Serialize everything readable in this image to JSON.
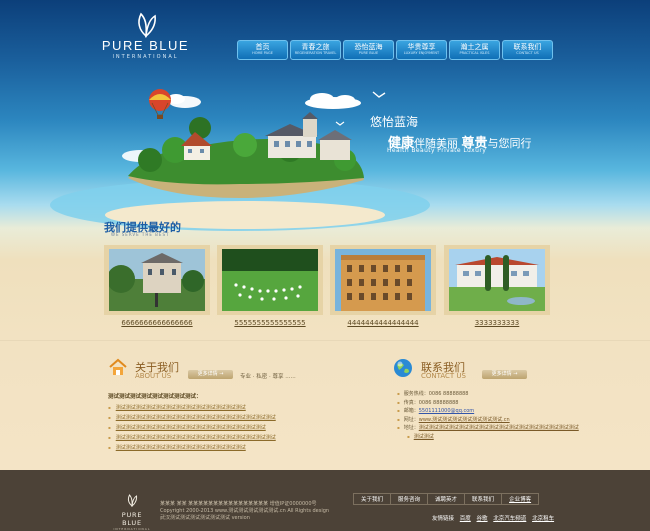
{
  "brand": {
    "name": "PURE BLUE",
    "tagline": "INTERNATIONAL"
  },
  "nav": [
    {
      "cn": "首页",
      "en": "HOME PAGE"
    },
    {
      "cn": "青春之旅",
      "en": "REGENERATION TRAVEL"
    },
    {
      "cn": "恐怡蓝海",
      "en": "PURE BLUE"
    },
    {
      "cn": "华贵尊享",
      "en": "LUXURY ENJOYMENT"
    },
    {
      "cn": "瀚土之属",
      "en": "PRACTICAL ISLES"
    },
    {
      "cn": "联系我们",
      "en": "CONTACT US"
    }
  ],
  "banner": {
    "line1": "悠怡蓝海",
    "line2_big1": "健康",
    "line2_mid": "伴随美丽",
    "line2_big2": "尊贵",
    "line2_end": "与您同行",
    "line3": "Health  Beauty  Private  Luxury"
  },
  "serve": {
    "title": "我们提供最好的",
    "subtitle": "WE SERVE THE BEST"
  },
  "gallery": [
    {
      "caption": "6666666666666666"
    },
    {
      "caption": "5555555555555555"
    },
    {
      "caption": "4444444444444444"
    },
    {
      "caption": "3333333333"
    }
  ],
  "about": {
    "title_cn": "关于我们",
    "title_en": "ABOUT US",
    "more": "更多详情 →",
    "tags": "专业 · 私密 · 尊享 ......",
    "heading": "测试测试测试测试测试测试测试测试：",
    "items": [
      "测试测试测试测试测试测试测试测试测试测试测试测试测试",
      "测试测试测试测试测试测试测试测试测试测试测试测试测试测试测试测试",
      "测试测试测试测试测试测试测试测试测试测试测试测试测试测试测试",
      "测试测试测试测试测试测试测试测试测试测试测试测试测试测试测试测试",
      "测试测试测试测试测试测试测试测试测试测试测试测试测试"
    ]
  },
  "contact": {
    "title_cn": "联系我们",
    "title_en": "CONTACT US",
    "more": "更多详情 →",
    "phone": "服务热线：0086 88888888",
    "fax": "传真：0086 88888888",
    "email_label": "邮箱：",
    "email": "5501111000@qq.com",
    "web_label": "网址：",
    "web": "www.测试测试测试测试测试测试测试.cn",
    "addr_label": "地址：",
    "addr_line1": "测试测试测试测试测试测试测试测试测试测试测试测试测试测试测试测试",
    "addr_line2": "测试测试"
  },
  "footer": {
    "logo_name": "PURE BLUE",
    "logo_sub": "INTERNATIONAL",
    "info1": "某某某 某某 某某某某某某某某某某某某某某某某  增值IP证0000000号",
    "info2": "Copyright 2000-2013 www.测试测试测试测试测试.cn All Rights  design",
    "info3": "武汉测试测试测试测试测试测试  version",
    "links": [
      "关于我们",
      "服务咨询",
      "诚聘英才",
      "联系我们",
      "企业博客"
    ],
    "friends_label": "友情链接",
    "friends": [
      "百度",
      "谷歌",
      "北京汽车频道",
      "北京租车"
    ]
  }
}
